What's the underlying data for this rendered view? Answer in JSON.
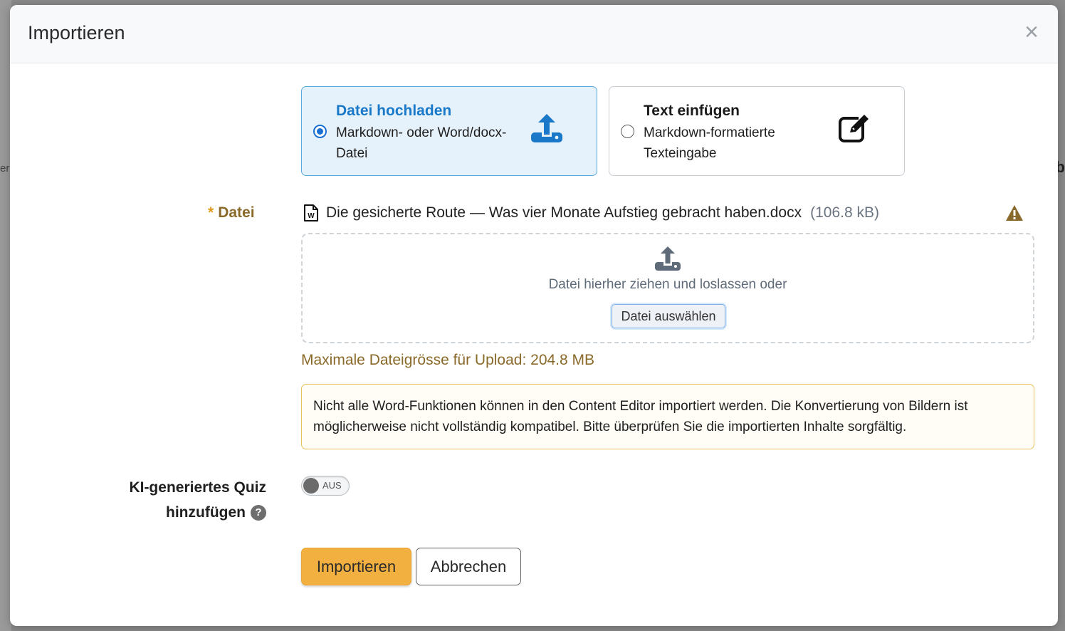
{
  "backdrop": {
    "left_fragment": "eru",
    "right_fragment": "b"
  },
  "modal": {
    "title": "Importieren",
    "close_glyph": "×"
  },
  "options": {
    "upload": {
      "title": "Datei hochladen",
      "description": "Markdown- oder Word/docx-Datei",
      "selected": true,
      "icon": "upload-icon"
    },
    "text": {
      "title": "Text einfügen",
      "description": "Markdown-formatierte Texteingabe",
      "selected": false,
      "icon": "edit-icon"
    }
  },
  "file_field": {
    "required_mark": "*",
    "label": "Datei",
    "file_name": "Die gesicherte Route — Was vier Monate Aufstieg gebracht haben.docx",
    "file_size": "(106.8 kB)",
    "file_icon": "word-file-icon",
    "warning_icon": "warning-icon"
  },
  "dropzone": {
    "text": "Datei hierher ziehen und loslassen oder",
    "button_label": "Datei auswählen"
  },
  "max_size": "Maximale Dateigrösse für Upload: 204.8 MB",
  "notice": "Nicht alle Word-Funktionen können in den Content Editor importiert werden. Die Konvertierung von Bildern ist möglicherweise nicht vollständig kompatibel. Bitte überprüfen Sie die importierten Inhalte sorgfältig.",
  "quiz": {
    "label_line1": "KI-generiertes Quiz",
    "label_line2": "hinzufügen",
    "help_glyph": "?",
    "toggle_text": "AUS",
    "toggle_on": false
  },
  "actions": {
    "import_label": "Importieren",
    "cancel_label": "Abbrechen"
  },
  "colors": {
    "accent_blue": "#1a78c8",
    "primary_button": "#f2b041",
    "label_brown": "#8a6a2a",
    "required_orange": "#e29a1c"
  }
}
